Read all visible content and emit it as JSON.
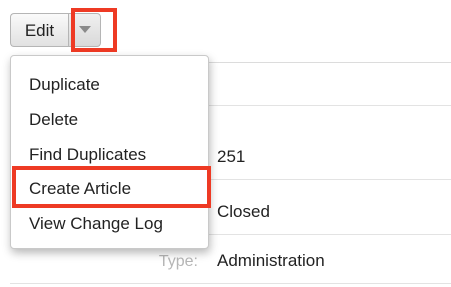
{
  "toolbar": {
    "edit_label": "Edit",
    "caret_icon": "chevron-down-icon"
  },
  "dropdown": {
    "items": [
      {
        "label": "Duplicate"
      },
      {
        "label": "Delete"
      },
      {
        "label": "Find Duplicates"
      },
      {
        "label": "Create Article",
        "highlighted": true
      },
      {
        "label": "View Change Log"
      }
    ]
  },
  "detail": {
    "rows": [
      {
        "label": "",
        "value": ""
      },
      {
        "label": "",
        "value": "251"
      },
      {
        "label": "",
        "value": "Closed"
      },
      {
        "label": "Type:",
        "value": "Administration"
      }
    ]
  },
  "colors": {
    "highlight": "#ee3a24",
    "label": "#b6b6b6"
  }
}
